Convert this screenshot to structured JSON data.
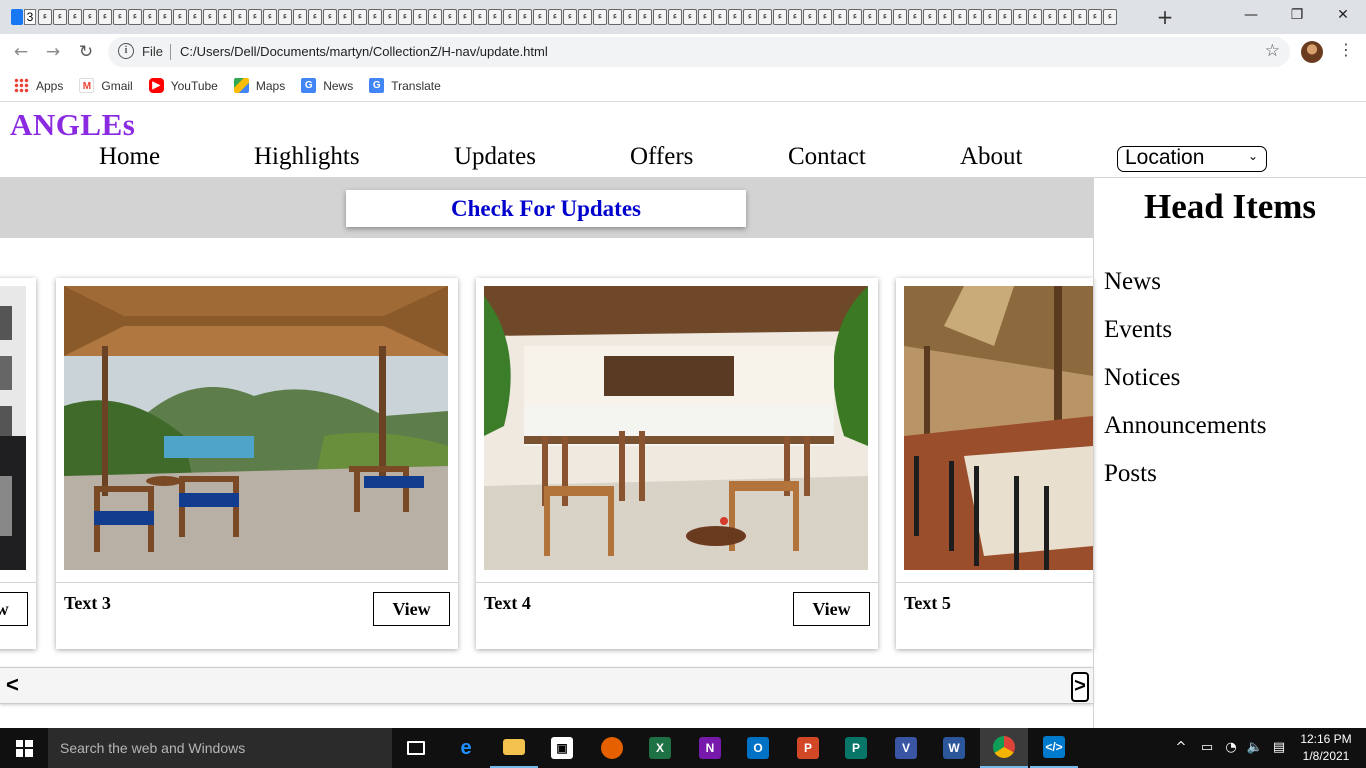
{
  "browser": {
    "tab_count_label": "3",
    "tab_icon_glyph": "ء",
    "new_tab_label": "+",
    "window": {
      "minimize": "—",
      "restore": "❐",
      "close": "✕"
    },
    "address": {
      "scheme_label": "File",
      "url": "C:/Users/Dell/Documents/martyn/CollectionZ/H-nav/update.html"
    },
    "bookmarks": [
      {
        "label": "Apps",
        "icon": "apps-grid-icon"
      },
      {
        "label": "Gmail",
        "icon": "gmail-icon"
      },
      {
        "label": "YouTube",
        "icon": "youtube-icon"
      },
      {
        "label": "Maps",
        "icon": "maps-icon"
      },
      {
        "label": "News",
        "icon": "news-icon"
      },
      {
        "label": "Translate",
        "icon": "translate-icon"
      }
    ]
  },
  "site": {
    "logo": "ANGLEs",
    "brand_color": "#8a2be2",
    "nav": [
      "Home",
      "Highlights",
      "Updates",
      "Offers",
      "Contact",
      "About"
    ],
    "location_select": {
      "selected": "Location"
    },
    "check_button": "Check For Updates",
    "check_button_color": "#0000cd",
    "sidebar": {
      "title": "Head Items",
      "items": [
        "News",
        "Events",
        "Notices",
        "Announcements",
        "Posts"
      ]
    },
    "cards": [
      {
        "text": "",
        "button": "View",
        "image": "restaurant-partial-photo"
      },
      {
        "text": "Text 3",
        "button": "View",
        "image": "thatched-veranda-photo"
      },
      {
        "text": "Text 4",
        "button": "View",
        "image": "lodge-bar-interior-photo"
      },
      {
        "text": "Text 5",
        "button": "",
        "image": "thatched-dining-room-photo"
      }
    ],
    "carousel": {
      "prev": "<",
      "next": ">"
    }
  },
  "taskbar": {
    "search_placeholder": "Search the web and Windows",
    "apps": [
      "task-view",
      "edge",
      "file-explorer",
      "store",
      "firefox",
      "excel",
      "onenote",
      "outlook",
      "powerpoint",
      "publisher",
      "visio",
      "word",
      "chrome",
      "vscode"
    ],
    "time": "12:16 PM",
    "date": "1/8/2021"
  }
}
